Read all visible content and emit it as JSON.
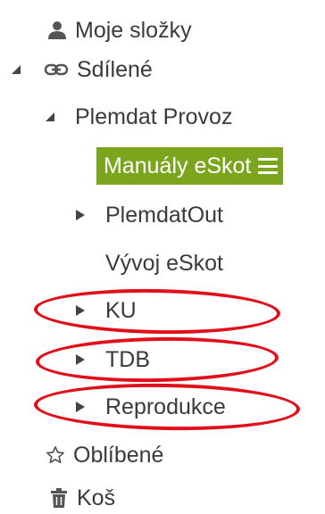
{
  "tree": {
    "my_folders": {
      "label": "Moje složky",
      "icon": "user-icon"
    },
    "shared": {
      "label": "Sdílené",
      "icon": "link-icon",
      "expanded": true
    },
    "plemdat_provoz": {
      "label": "Plemdat Provoz",
      "expanded": true
    },
    "manualy_eskot": {
      "label": "Manuály eSkot",
      "selected": true,
      "menu_icon": "hamburger-menu-icon"
    },
    "plemdat_out": {
      "label": "PlemdatOut",
      "expanded": false
    },
    "vyvoj_eskot": {
      "label": "Vývoj eSkot"
    },
    "ku": {
      "label": "KU",
      "expanded": false
    },
    "tdb": {
      "label": "TDB",
      "expanded": false
    },
    "reprodukce": {
      "label": "Reprodukce",
      "expanded": false
    },
    "favorites": {
      "label": "Oblíbené",
      "icon": "star-outline-icon"
    },
    "trash": {
      "label": "Koš",
      "icon": "trash-icon"
    }
  },
  "colors": {
    "selected_background": "#7ca51e",
    "annotation_circle": "#e0101a",
    "text": "#3a3a3a"
  }
}
